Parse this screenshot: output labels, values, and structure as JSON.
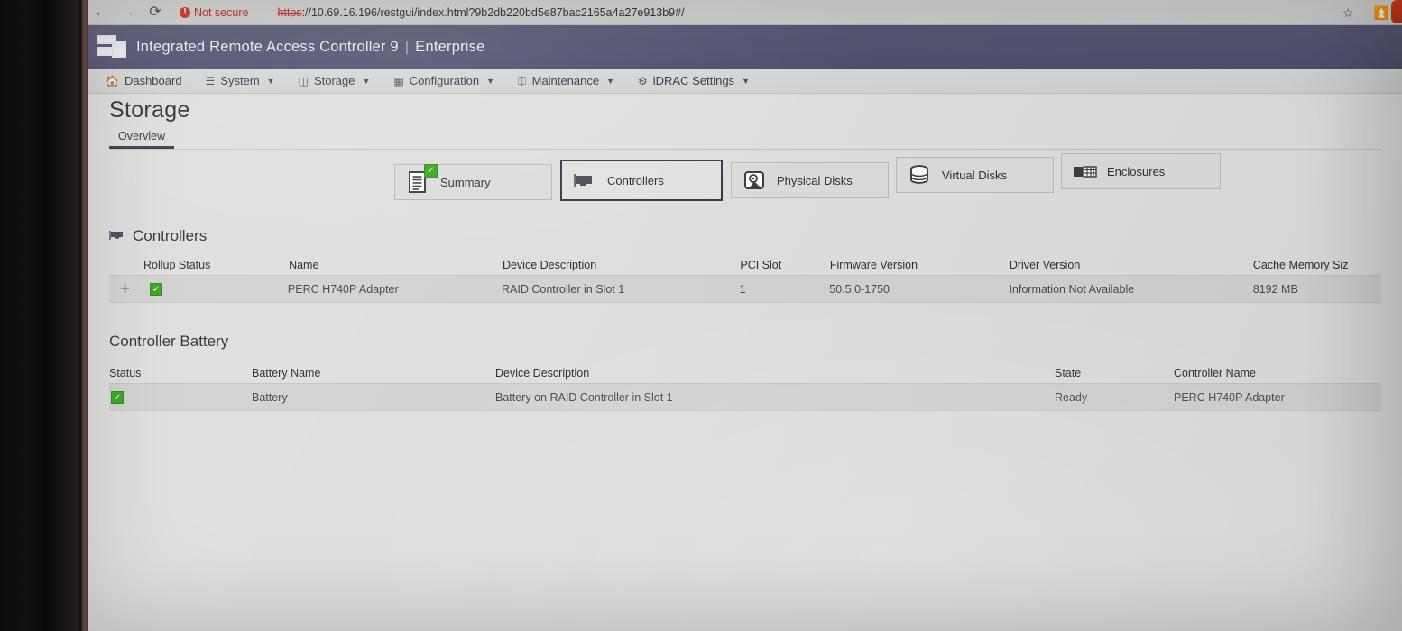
{
  "browser": {
    "back_icon": "back-arrow-icon",
    "forward_icon": "forward-arrow-icon",
    "reload_icon": "reload-icon",
    "security_label": "Not secure",
    "url_scheme": "https",
    "url_rest": "://10.69.16.196/restgui/index.html?9b2db220bd5e87bac2165a4a27e913b9#/",
    "bookmark_icon": "star-icon",
    "download_icon": "download-icon"
  },
  "header": {
    "product": "Integrated Remote Access Controller 9",
    "separator": "|",
    "edition": "Enterprise",
    "logo_icon": "idrac-server-logo-icon",
    "brand_color": "#545470"
  },
  "nav": {
    "items": [
      {
        "label": "Dashboard",
        "icon": "home-icon",
        "has_caret": false
      },
      {
        "label": "System",
        "icon": "server-icon",
        "has_caret": true
      },
      {
        "label": "Storage",
        "icon": "storage-icon",
        "has_caret": true
      },
      {
        "label": "Configuration",
        "icon": "grid-icon",
        "has_caret": true
      },
      {
        "label": "Maintenance",
        "icon": "wrench-icon",
        "has_caret": true
      },
      {
        "label": "iDRAC Settings",
        "icon": "gear-icon",
        "has_caret": true
      }
    ]
  },
  "page": {
    "title": "Storage",
    "tabs": [
      {
        "label": "Overview",
        "active": true
      }
    ]
  },
  "categories": [
    {
      "label": "Summary",
      "icon": "list-document-icon",
      "selected": false,
      "badge": "ok"
    },
    {
      "label": "Controllers",
      "icon": "controller-card-icon",
      "selected": true,
      "badge": ""
    },
    {
      "label": "Physical Disks",
      "icon": "hard-disk-icon",
      "selected": false,
      "badge": ""
    },
    {
      "label": "Virtual Disks",
      "icon": "database-icon",
      "selected": false,
      "badge": ""
    },
    {
      "label": "Enclosures",
      "icon": "enclosure-icon",
      "selected": false,
      "badge": ""
    }
  ],
  "controllers_section": {
    "heading": "Controllers",
    "heading_icon": "controller-card-icon",
    "columns": [
      "Rollup Status",
      "Name",
      "Device Description",
      "PCI Slot",
      "Firmware Version",
      "Driver Version",
      "Cache Memory Siz"
    ],
    "rows": [
      {
        "expand": "+",
        "rollup_status": "ok",
        "name": "PERC H740P Adapter",
        "device_description": "RAID Controller in Slot 1",
        "pci_slot": "1",
        "firmware_version": "50.5.0-1750",
        "driver_version": "Information Not Available",
        "cache_memory_size": "8192 MB"
      }
    ]
  },
  "battery_section": {
    "heading": "Controller Battery",
    "columns": [
      "Status",
      "Battery Name",
      "Device Description",
      "State",
      "Controller Name"
    ],
    "rows": [
      {
        "status": "ok",
        "battery_name": "Battery",
        "device_description": "Battery on RAID Controller in Slot 1",
        "state": "Ready",
        "controller_name": "PERC H740P Adapter"
      }
    ]
  },
  "status_colors": {
    "ok": "#3aa821",
    "insecure": "#c5221f"
  }
}
